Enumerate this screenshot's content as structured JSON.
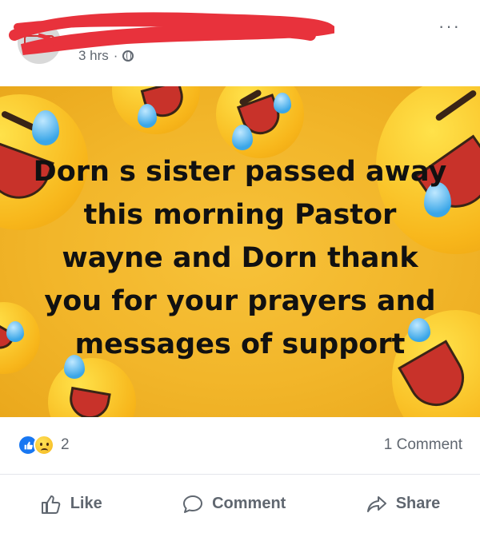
{
  "post": {
    "timestamp": "3 hrs",
    "separator": "·",
    "privacy_icon": "globe-icon",
    "more_label": "···",
    "image_text": "Dorn s sister passed away this morning Pastor wayne and Dorn thank you for your prayers and messages of support"
  },
  "reactions": {
    "icons": [
      "like-icon",
      "sad-icon"
    ],
    "count": "2",
    "comments": "1 Comment"
  },
  "actions": {
    "like_label": "Like",
    "comment_label": "Comment",
    "share_label": "Share"
  },
  "colors": {
    "image_background": "#f2b62a",
    "redaction": "#e8323c",
    "like_blue": "#1877f2",
    "muted_text": "#606770"
  }
}
